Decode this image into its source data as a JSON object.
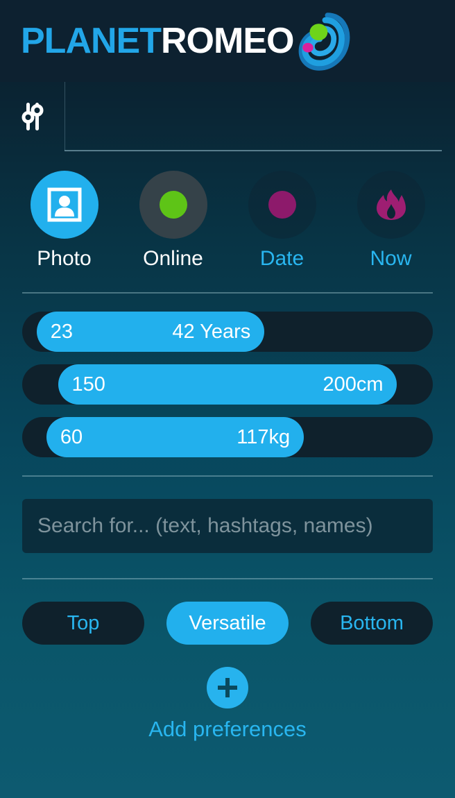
{
  "app": {
    "brand_first": "PLANET",
    "brand_second": "ROMEO",
    "brand_color_first": "#22a6e8",
    "brand_color_second": "#ffffff",
    "orb_colors": {
      "ring": "#1f9fe0",
      "ring_dark": "#1678b8",
      "green": "#6ed41a",
      "magenta": "#d9219c"
    }
  },
  "tabbar": {
    "filter_tab": {
      "icon": "sliders-icon",
      "selected": true,
      "label": ""
    }
  },
  "quick_filters": [
    {
      "label": "Photo",
      "icon": "photo-portrait-icon",
      "state": "active",
      "circle_color": "#22b0ed",
      "label_color": "#ffffff"
    },
    {
      "label": "Online",
      "icon": "green-dot-icon",
      "state": "inactive",
      "circle_color": "#354249",
      "label_color": "#ffffff",
      "dot_color": "#5ec417"
    },
    {
      "label": "Date",
      "icon": "purple-dot-icon",
      "state": "inactive",
      "circle_color": "#0c2634",
      "label_color": "#29b6f0",
      "dot_color": "#8d1a6b"
    },
    {
      "label": "Now",
      "icon": "flame-icon",
      "state": "inactive",
      "circle_color": "#0c2634",
      "label_color": "#29b6f0",
      "dot_color": "#9e1e72"
    }
  ],
  "range_sliders": [
    {
      "name": "age",
      "min_label": "23",
      "max_label": "42 Years",
      "min_value": 23,
      "max_value": 42,
      "unit": "Years",
      "fill_start_pct": 3.5,
      "fill_width_pct": 55.5
    },
    {
      "name": "height",
      "min_label": "150",
      "max_label": "200cm",
      "min_value": 150,
      "max_value": 200,
      "unit": "cm",
      "fill_start_pct": 8.7,
      "fill_width_pct": 82.6
    },
    {
      "name": "weight",
      "min_label": "60",
      "max_label": "117kg",
      "min_value": 60,
      "max_value": 117,
      "unit": "kg",
      "fill_start_pct": 5.9,
      "fill_width_pct": 62.7
    }
  ],
  "search": {
    "placeholder": "Search for... (text, hashtags, names)",
    "value": ""
  },
  "role_buttons": [
    {
      "label": "Top",
      "selected": false
    },
    {
      "label": "Versatile",
      "selected": true
    },
    {
      "label": "Bottom",
      "selected": false
    }
  ],
  "add_preferences": {
    "label": "Add preferences",
    "icon": "plus-icon",
    "accent_color": "#27b3ee"
  },
  "theme": {
    "accent_blue": "#22b0ed",
    "link_blue": "#29b6f0",
    "track_dark": "#0f212c",
    "header_bg": "#0d2130",
    "divider": "#a5c8d2"
  }
}
